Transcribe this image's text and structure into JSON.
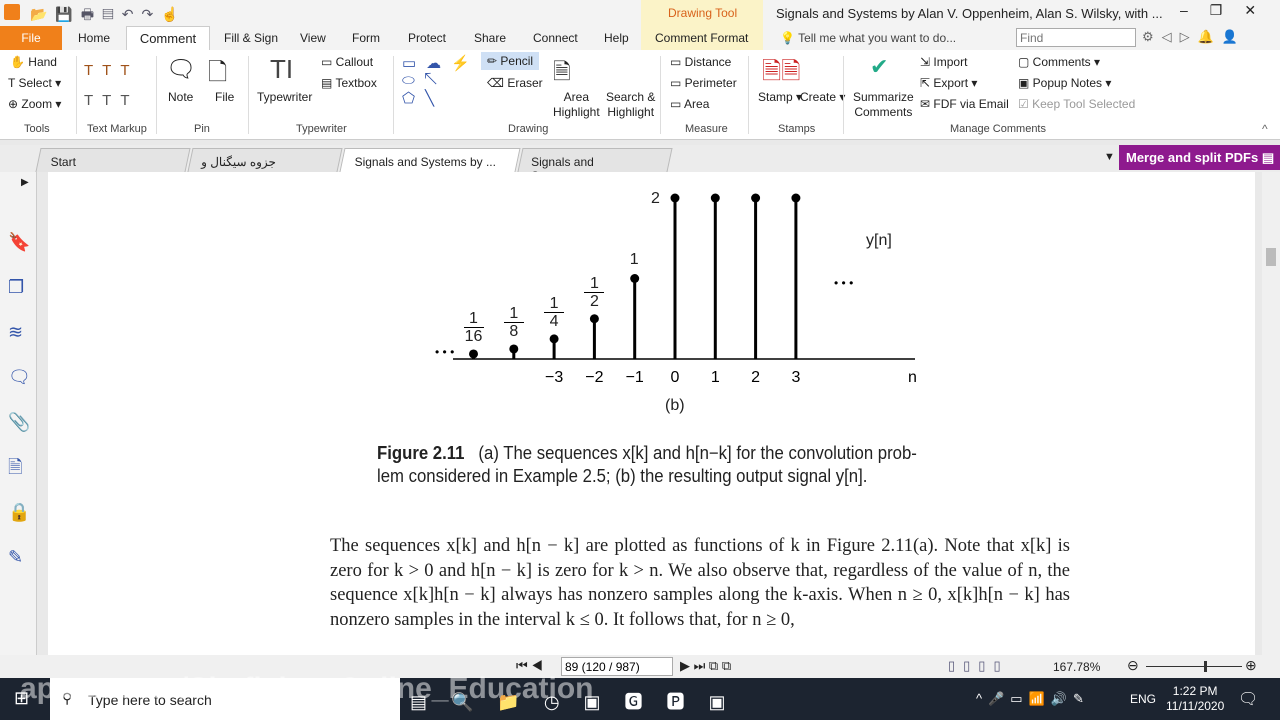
{
  "window": {
    "title": "Signals and Systems by Alan V. Oppenheim, Alan S. Wilsky, with ...",
    "context_tab": "Drawing Tool",
    "context_sub": "Comment Format"
  },
  "menu": {
    "file": "File",
    "items": [
      "Home",
      "Comment",
      "Fill & Sign",
      "View",
      "Form",
      "Protect",
      "Share",
      "Connect",
      "Help"
    ],
    "tell_me": "Tell me what you want to do...",
    "find_placeholder": "Find"
  },
  "ribbon": {
    "tools": {
      "hand": "Hand",
      "select": "Select",
      "zoom": "Zoom",
      "group": "Tools"
    },
    "text_markup": {
      "group": "Text Markup"
    },
    "pin": {
      "note": "Note",
      "file": "File",
      "group": "Pin"
    },
    "typewriter": {
      "typewriter": "Typewriter",
      "callout": "Callout",
      "textbox": "Textbox",
      "group": "Typewriter"
    },
    "drawing": {
      "pencil": "Pencil",
      "eraser": "Eraser",
      "area_highlight": [
        "Area",
        "Highlight"
      ],
      "search_highlight": [
        "Search &",
        "Highlight"
      ],
      "group": "Drawing"
    },
    "measure": {
      "distance": "Distance",
      "perimeter": "Perimeter",
      "area": "Area",
      "group": "Measure"
    },
    "stamps": {
      "stamp": "Stamp",
      "create": "Create",
      "group": "Stamps"
    },
    "manage": {
      "summarize": [
        "Summarize",
        "Comments"
      ],
      "import": "Import",
      "export": "Export",
      "fdf": "FDF via Email",
      "comments": "Comments",
      "popup": "Popup Notes",
      "keep": "Keep Tool Selected",
      "group": "Manage Comments"
    }
  },
  "doc_tabs": [
    "Start",
    "جزوه سیگنال و سیستم...",
    "Signals and Systems by ...",
    "Signals and Systems_..."
  ],
  "merge_banner": "Merge and split PDFs",
  "figure": {
    "stems": [
      {
        "n": -5,
        "v": 0.0625,
        "label": [
          "1",
          "16"
        ]
      },
      {
        "n": -4,
        "v": 0.125,
        "label": [
          "1",
          "8"
        ]
      },
      {
        "n": -3,
        "v": 0.25,
        "label": [
          "1",
          "4"
        ]
      },
      {
        "n": -2,
        "v": 0.5,
        "label": [
          "1",
          "2"
        ]
      },
      {
        "n": -1,
        "v": 1,
        "label": "1"
      },
      {
        "n": 0,
        "v": 2,
        "label": "2"
      },
      {
        "n": 1,
        "v": 2
      },
      {
        "n": 2,
        "v": 2
      },
      {
        "n": 3,
        "v": 2
      }
    ],
    "ticks": [
      "−3",
      "−2",
      "−1",
      "0",
      "1",
      "2",
      "3"
    ],
    "axis_label": "n",
    "signal_label": "y[n]",
    "sub_label": "(b)",
    "dots": "• • •"
  },
  "caption": {
    "label": "Figure 2.11",
    "line1": "(a) The sequences x[k] and h[n−k] for the convolution prob-",
    "line2": "lem considered in Example 2.5; (b) the resulting output signal y[n]."
  },
  "body": "The sequences x[k] and h[n − k] are plotted as functions of k in Figure 2.11(a). Note that x[k] is zero for k > 0 and h[n − k] is zero for k > n. We also observe that, regardless of the value of n, the sequence x[k]h[n − k] always has nonzero samples along the k-axis. When n ≥ 0, x[k]h[n − k] has nonzero samples in the interval k ≤ 0. It follows that, for n ≥ 0,",
  "status": {
    "page": "89 (120 / 987)",
    "zoom": "167.78%",
    "zoom_level": 0.6
  },
  "taskbar": {
    "search": "Type here to search",
    "lang": "ENG",
    "time": "1:22 PM",
    "date": "11/11/2020",
    "watermark": "aparat.com/Shafieian_Online_Education"
  }
}
